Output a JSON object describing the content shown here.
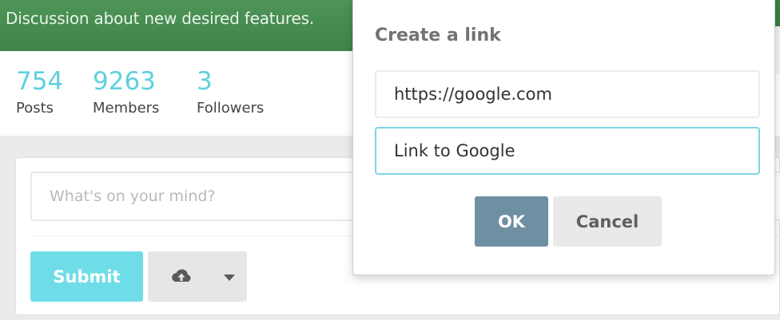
{
  "banner": {
    "description": "Discussion about new desired features."
  },
  "stats": [
    {
      "value": "754",
      "label": "Posts"
    },
    {
      "value": "9263",
      "label": "Members"
    },
    {
      "value": "3",
      "label": "Followers"
    }
  ],
  "composer": {
    "placeholder": "What's on your mind?",
    "submit_label": "Submit",
    "upload_icon": "cloud-upload-icon",
    "dropdown_icon": "caret-down-icon"
  },
  "dialog": {
    "title": "Create a link",
    "url_value": "https://google.com",
    "text_value": "Link to Google",
    "ok_label": "OK",
    "cancel_label": "Cancel"
  },
  "colors": {
    "banner": "#3f8448",
    "stat_accent": "#5fd0de",
    "submit": "#6fdde8",
    "ok": "#6f8fa3",
    "focus_border": "#7dd6e3"
  }
}
